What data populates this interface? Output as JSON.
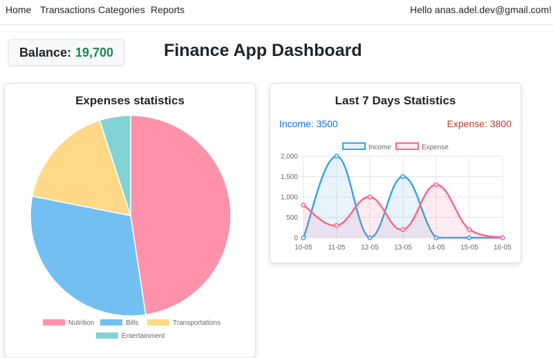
{
  "nav": {
    "links": [
      "Home",
      "Transactions",
      "Categories",
      "Reports"
    ],
    "greeting": "Hello anas.adel.dev@gmail.com!"
  },
  "balance": {
    "label": "Balance:",
    "value": "19,700"
  },
  "page_title": "Finance App Dashboard",
  "expenses_card": {
    "title": "Expenses statistics"
  },
  "week_card": {
    "title": "Last 7 Days Statistics",
    "income_label": "Income: 3500",
    "expense_label": "Expense: 3800"
  },
  "colors": {
    "nutrition": "#ff92aa",
    "bills": "#73bff2",
    "transportations": "#ffd987",
    "entertainment": "#82d3d3",
    "income": "#36a2eb",
    "expense": "#ff6384"
  },
  "chart_data": [
    {
      "type": "pie",
      "title": "Expenses statistics",
      "labels": [
        "Nutrition",
        "Bills",
        "Transportations",
        "Entertainment"
      ],
      "values": [
        47.6,
        30.5,
        16.9,
        5.0
      ],
      "legend": "bottom"
    },
    {
      "type": "line",
      "title": "Last 7 Days Statistics",
      "categories": [
        "10-05",
        "11-05",
        "12-05",
        "13-05",
        "14-05",
        "15-05",
        "16-05"
      ],
      "series": [
        {
          "name": "Income",
          "values": [
            0,
            2000,
            0,
            1500,
            0,
            0,
            0
          ]
        },
        {
          "name": "Expense",
          "values": [
            800,
            300,
            1000,
            200,
            1300,
            200,
            0
          ]
        }
      ],
      "yticks": [
        "0",
        "500",
        "1,000",
        "1,500",
        "2,000"
      ],
      "ylim": [
        0,
        2000
      ],
      "grid": true,
      "legend": "top"
    }
  ]
}
